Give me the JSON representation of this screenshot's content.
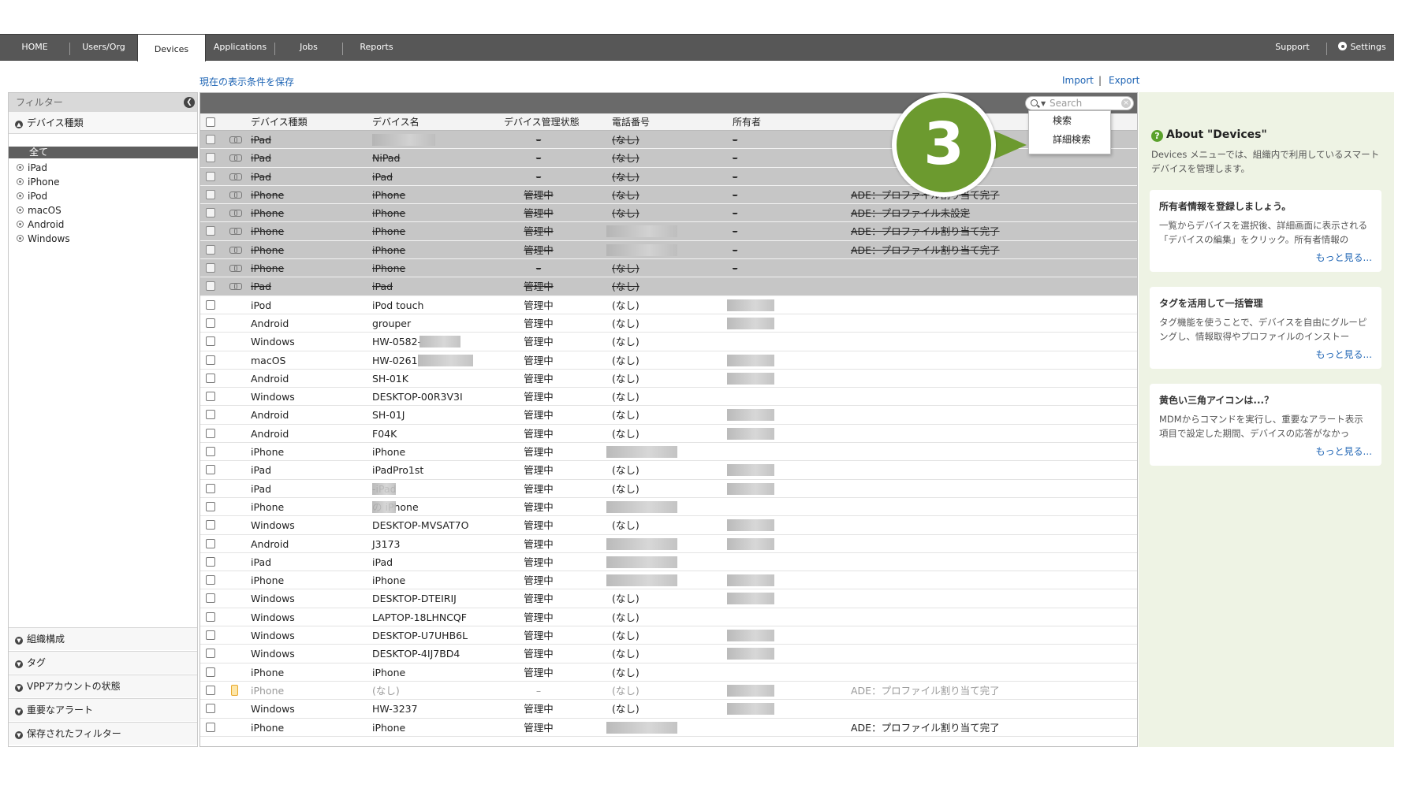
{
  "nav": {
    "items": [
      "HOME",
      "Users/Org",
      "Devices",
      "Applications",
      "Jobs",
      "Reports"
    ],
    "active": "Devices",
    "support": "Support",
    "settings": "Settings"
  },
  "toolbar_links": {
    "save_view": "現在の表示条件を保存",
    "import": "Import",
    "export": "Export",
    "separator": "|"
  },
  "sidebar": {
    "title": "フィルター",
    "device_type_section": "デバイス種類",
    "all_label": "全て",
    "types": [
      "iPad",
      "iPhone",
      "iPod",
      "macOS",
      "Android",
      "Windows"
    ],
    "bottom_sections": [
      "組織構成",
      "タグ",
      "VPPアカウントの状態",
      "重要なアラート",
      "保存されたフィルター"
    ]
  },
  "search": {
    "placeholder": "Search",
    "menu": [
      "検索",
      "詳細検索"
    ]
  },
  "table": {
    "headers": [
      "デバイス種類",
      "デバイス名",
      "デバイス管理状態",
      "電話番号",
      "所有者"
    ],
    "rows": [
      {
        "type": "iPad",
        "name": "",
        "status": "–",
        "phone": "(なし)",
        "owner": "–",
        "extra": "",
        "style": "gray"
      },
      {
        "type": "iPad",
        "name": "NiPad",
        "status": "–",
        "phone": "(なし)",
        "owner": "–",
        "extra": "",
        "style": "gray"
      },
      {
        "type": "iPad",
        "name": "iPad",
        "status": "–",
        "phone": "(なし)",
        "owner": "–",
        "extra": "",
        "style": "gray"
      },
      {
        "type": "iPhone",
        "name": "iPhone",
        "status": "管理中",
        "phone": "(なし)",
        "owner": "–",
        "extra": "ADE：プロファイル割り当て完了",
        "style": "gray"
      },
      {
        "type": "iPhone",
        "name": "iPhone",
        "status": "管理中",
        "phone": "(なし)",
        "owner": "–",
        "extra": "ADE：プロファイル未設定",
        "style": "gray"
      },
      {
        "type": "iPhone",
        "name": "iPhone",
        "status": "管理中",
        "phone": "",
        "owner": "–",
        "extra": "ADE：プロファイル割り当て完了",
        "style": "gray"
      },
      {
        "type": "iPhone",
        "name": "iPhone",
        "status": "管理中",
        "phone": "",
        "owner": "–",
        "extra": "ADE：プロファイル割り当て完了",
        "style": "gray"
      },
      {
        "type": "iPhone",
        "name": "iPhone",
        "status": "–",
        "phone": "(なし)",
        "owner": "–",
        "extra": "",
        "style": "gray"
      },
      {
        "type": "iPad",
        "name": "iPad",
        "status": "管理中",
        "phone": "(なし)",
        "owner": "",
        "extra": "",
        "style": "gray"
      },
      {
        "type": "iPod",
        "name": "iPod touch",
        "status": "管理中",
        "phone": "(なし)",
        "owner": "",
        "extra": "",
        "style": "normal"
      },
      {
        "type": "Android",
        "name": "grouper",
        "status": "管理中",
        "phone": "(なし)",
        "owner": "",
        "extra": "",
        "style": "normal"
      },
      {
        "type": "Windows",
        "name": "HW-0582-",
        "status": "管理中",
        "phone": "(なし)",
        "owner": "",
        "extra": "",
        "style": "normal"
      },
      {
        "type": "macOS",
        "name": "HW-0261",
        "status": "管理中",
        "phone": "(なし)",
        "owner": "",
        "extra": "",
        "style": "normal"
      },
      {
        "type": "Android",
        "name": "SH-01K",
        "status": "管理中",
        "phone": "(なし)",
        "owner": "",
        "extra": "",
        "style": "normal"
      },
      {
        "type": "Windows",
        "name": "DESKTOP-00R3V3I",
        "status": "管理中",
        "phone": "(なし)",
        "owner": "",
        "extra": "",
        "style": "normal"
      },
      {
        "type": "Android",
        "name": "SH-01J",
        "status": "管理中",
        "phone": "(なし)",
        "owner": "",
        "extra": "",
        "style": "normal"
      },
      {
        "type": "Android",
        "name": "F04K",
        "status": "管理中",
        "phone": "(なし)",
        "owner": "",
        "extra": "",
        "style": "normal"
      },
      {
        "type": "iPhone",
        "name": "iPhone",
        "status": "管理中",
        "phone": "",
        "owner": "",
        "extra": "",
        "style": "normal"
      },
      {
        "type": "iPad",
        "name": "iPadPro1st",
        "status": "管理中",
        "phone": "(なし)",
        "owner": "",
        "extra": "",
        "style": "normal"
      },
      {
        "type": "iPad",
        "name": "-iPad",
        "status": "管理中",
        "phone": "(なし)",
        "owner": "",
        "extra": "",
        "style": "normal"
      },
      {
        "type": "iPhone",
        "name": "の iPhone",
        "status": "管理中",
        "phone": "",
        "owner": "",
        "extra": "",
        "style": "normal"
      },
      {
        "type": "Windows",
        "name": "DESKTOP-MVSAT7O",
        "status": "管理中",
        "phone": "(なし)",
        "owner": "",
        "extra": "",
        "style": "normal"
      },
      {
        "type": "Android",
        "name": "J3173",
        "status": "管理中",
        "phone": "",
        "owner": "",
        "extra": "",
        "style": "normal"
      },
      {
        "type": "iPad",
        "name": "iPad",
        "status": "管理中",
        "phone": "",
        "owner": "",
        "extra": "",
        "style": "normal"
      },
      {
        "type": "iPhone",
        "name": "iPhone",
        "status": "管理中",
        "phone": "",
        "owner": "",
        "extra": "",
        "style": "normal"
      },
      {
        "type": "Windows",
        "name": "DESKTOP-DTEIRIJ",
        "status": "管理中",
        "phone": "(なし)",
        "owner": "",
        "extra": "",
        "style": "normal"
      },
      {
        "type": "Windows",
        "name": "LAPTOP-18LHNCQF",
        "status": "管理中",
        "phone": "(なし)",
        "owner": "",
        "extra": "",
        "style": "normal"
      },
      {
        "type": "Windows",
        "name": "DESKTOP-U7UHB6L",
        "status": "管理中",
        "phone": "(なし)",
        "owner": "",
        "extra": "",
        "style": "normal"
      },
      {
        "type": "Windows",
        "name": "DESKTOP-4IJ7BD4",
        "status": "管理中",
        "phone": "(なし)",
        "owner": "",
        "extra": "",
        "style": "normal"
      },
      {
        "type": "iPhone",
        "name": "iPhone",
        "status": "管理中",
        "phone": "(なし)",
        "owner": "",
        "extra": "",
        "style": "normal"
      },
      {
        "type": "iPhone",
        "name": "(なし)",
        "status": "–",
        "phone": "(なし)",
        "owner": "",
        "extra": "ADE：プロファイル割り当て完了",
        "style": "dim"
      },
      {
        "type": "Windows",
        "name": "HW-3237",
        "status": "管理中",
        "phone": "(なし)",
        "owner": "",
        "extra": "",
        "style": "normal"
      },
      {
        "type": "iPhone",
        "name": "iPhone",
        "status": "管理中",
        "phone": "",
        "owner": "",
        "extra": "ADE：プロファイル割り当て完了",
        "style": "normal"
      }
    ]
  },
  "callout": {
    "number": "3"
  },
  "panel": {
    "about_title": "About \"Devices\"",
    "about_text": "Devices メニューでは、組織内で利用しているスマートデバイスを管理します。",
    "cards": [
      {
        "title": "所有者情報を登録しましょう。",
        "text": "一覧からデバイスを選択後、詳細画面に表示される「デバイスの編集」をクリック。所有者情報の",
        "more": "もっと見る..."
      },
      {
        "title": "タグを活用して一括管理",
        "text": "タグ機能を使うことで、デバイスを自由にグルーピングし、情報取得やプロファイルのインストー",
        "more": "もっと見る..."
      },
      {
        "title": "黄色い三角アイコンは...？",
        "text": "MDMからコマンドを実行し、重要なアラート表示項目で設定した期間、デバイスの応答がなかっ",
        "more": "もっと見る..."
      }
    ]
  },
  "colors": {
    "nav_bg": "#575757",
    "link": "#1e64b4",
    "callout": "#6c9a2f",
    "panel_bg": "#eef3e4",
    "disabled_row": "#c6c6c6"
  }
}
